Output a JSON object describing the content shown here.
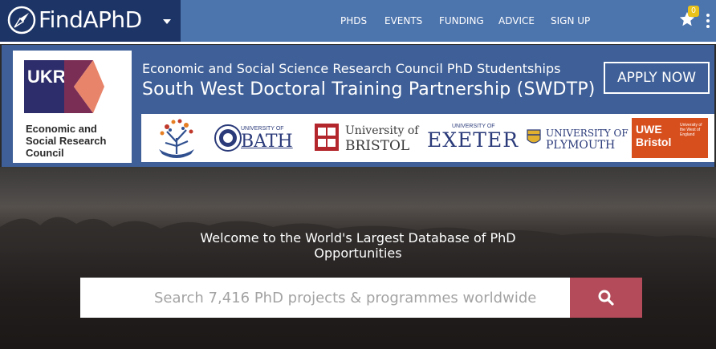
{
  "header": {
    "brand": "FindAPhD",
    "nav": [
      "PHDS",
      "EVENTS",
      "FUNDING",
      "ADVICE",
      "SIGN UP"
    ],
    "favourites_count": "0"
  },
  "banner": {
    "funder_logo_text": "UKRI",
    "funder_name": "Economic and Social Research Council",
    "line1": "Economic and Social Science Research Council PhD Studentships",
    "line2": "South West Doctoral Training Partnership (SWDTP)",
    "apply_label": "APPLY NOW",
    "partners": [
      {
        "top": "UNIVERSITY OF",
        "name": "BATH"
      },
      {
        "top": "University of",
        "name": "BRISTOL"
      },
      {
        "top": "UNIVERSITY OF",
        "name": "EXETER"
      },
      {
        "top": "UNIVERSITY OF",
        "name": "PLYMOUTH"
      },
      {
        "top": "UWE",
        "name": "Bristol",
        "small": "University of the West of England"
      }
    ]
  },
  "hero": {
    "title": "Welcome to the World's Largest Database of PhD Opportunities",
    "search_placeholder": "Search 7,416 PhD projects & programmes worldwide"
  },
  "colors": {
    "nav_bg": "#4c74ad",
    "logo_bg": "#1d3466",
    "banner_bg": "#3e5f97",
    "search_button": "#b34b5a",
    "badge": "#e8c21a"
  },
  "icons": [
    "compass-icon",
    "caret-down-icon",
    "star-icon",
    "more-vert-icon",
    "search-icon"
  ]
}
